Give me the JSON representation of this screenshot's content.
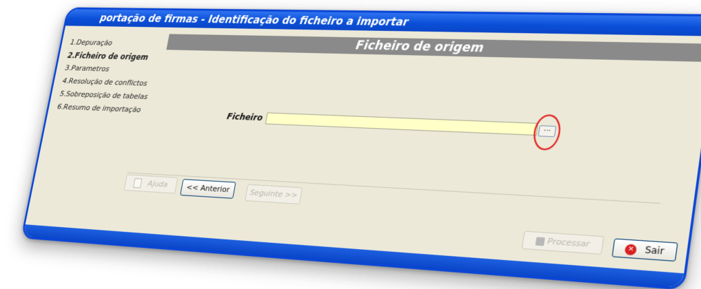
{
  "window": {
    "title": "portação de firmas - Identificação do ficheiro a importar"
  },
  "steps": [
    {
      "label": "1.Depuração",
      "active": false
    },
    {
      "label": "2.Ficheiro de origem",
      "active": true
    },
    {
      "label": "3.Parametros",
      "active": false
    },
    {
      "label": "4.Resolução de conflictos",
      "active": false
    },
    {
      "label": "5.Sobreposição de tabelas",
      "active": false
    },
    {
      "label": "6.Resumo de importação",
      "active": false
    }
  ],
  "header": {
    "title": "Ficheiro de origem"
  },
  "form": {
    "file_label": "Ficheiro",
    "file_value": "",
    "browse_label": "..."
  },
  "buttons": {
    "help": "Ajuda",
    "previous": "<< Anterior",
    "next": "Seguinte >>",
    "process": "Processar",
    "exit": "Sair"
  },
  "colors": {
    "title_bar": "#0a4fd8",
    "panel": "#ece9d8",
    "header_bar": "#8a8a8a",
    "input_bg": "#ffffc8",
    "annotation": "#e01a1a"
  }
}
